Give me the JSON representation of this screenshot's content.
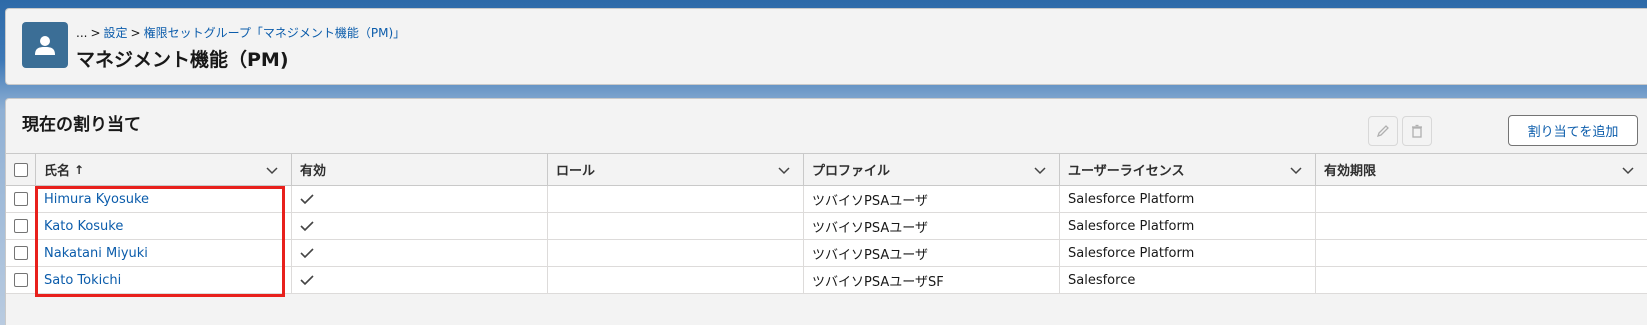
{
  "breadcrumb": {
    "ellipsis": "...",
    "sep1": ">",
    "setup": "設定",
    "sep2": ">",
    "group": "権限セットグループ「マネジメント機能（PM)」"
  },
  "page": {
    "title": "マネジメント機能（PM)",
    "avatar_icon": "user-icon"
  },
  "assignments": {
    "title": "現在の割り当て",
    "edit_icon": "pencil-icon",
    "delete_icon": "trash-icon",
    "add_button": "割り当てを追加",
    "columns": {
      "name": "氏名",
      "sort_indicator": "↑",
      "active": "有効",
      "role": "ロール",
      "profile": "プロファイル",
      "license": "ユーザーライセンス",
      "expiry": "有効期限"
    },
    "rows": [
      {
        "name": "Himura Kyosuke",
        "active": true,
        "role": "",
        "profile": "ツバイソPSAユーザ",
        "license": "Salesforce Platform",
        "expiry": ""
      },
      {
        "name": "Kato Kosuke",
        "active": true,
        "role": "",
        "profile": "ツバイソPSAユーザ",
        "license": "Salesforce Platform",
        "expiry": ""
      },
      {
        "name": "Nakatani Miyuki",
        "active": true,
        "role": "",
        "profile": "ツバイソPSAユーザ",
        "license": "Salesforce Platform",
        "expiry": ""
      },
      {
        "name": "Sato Tokichi",
        "active": true,
        "role": "",
        "profile": "ツバイソPSAユーザSF",
        "license": "Salesforce",
        "expiry": ""
      }
    ]
  },
  "colors": {
    "link": "#0b5cab",
    "highlight": "#e8201c",
    "avatar_bg": "#3b6e96"
  }
}
